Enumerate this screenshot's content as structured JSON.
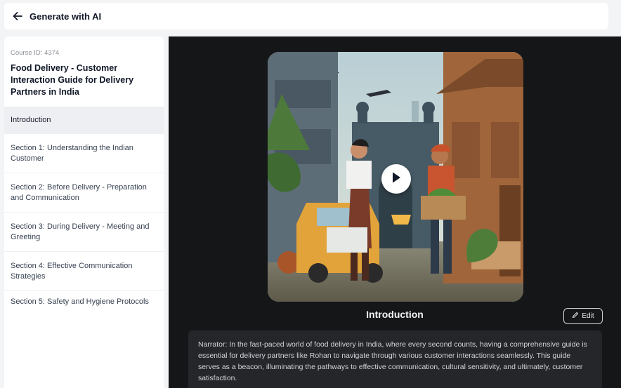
{
  "header": {
    "title": "Generate with AI",
    "back_icon": "arrow-left-icon"
  },
  "sidebar": {
    "course_id": "Course ID: 4374",
    "course_title": "Food Delivery - Customer Interaction Guide for Delivery Partners in India",
    "items": [
      {
        "label": "Introduction",
        "active": true
      },
      {
        "label": "Section 1: Understanding the Indian Customer"
      },
      {
        "label": "Section 2: Before Delivery - Preparation and Communication"
      },
      {
        "label": "Section 3: During Delivery - Meeting and Greeting"
      },
      {
        "label": "Section 4: Effective Communication Strategies"
      },
      {
        "label": "Section 5: Safety and Hygiene Protocols"
      }
    ]
  },
  "main": {
    "video_icon": "play-icon",
    "section_title": "Introduction",
    "edit_label": "Edit",
    "edit_icon": "pencil-icon",
    "narration": "Narrator: In the fast-paced world of food delivery in India, where every second counts, having a comprehensive guide is essential for delivery partners like Rohan to navigate through various customer interactions seamlessly. This guide serves as a beacon, illuminating the pathways to effective communication, cultural sensitivity, and ultimately, customer satisfaction."
  }
}
